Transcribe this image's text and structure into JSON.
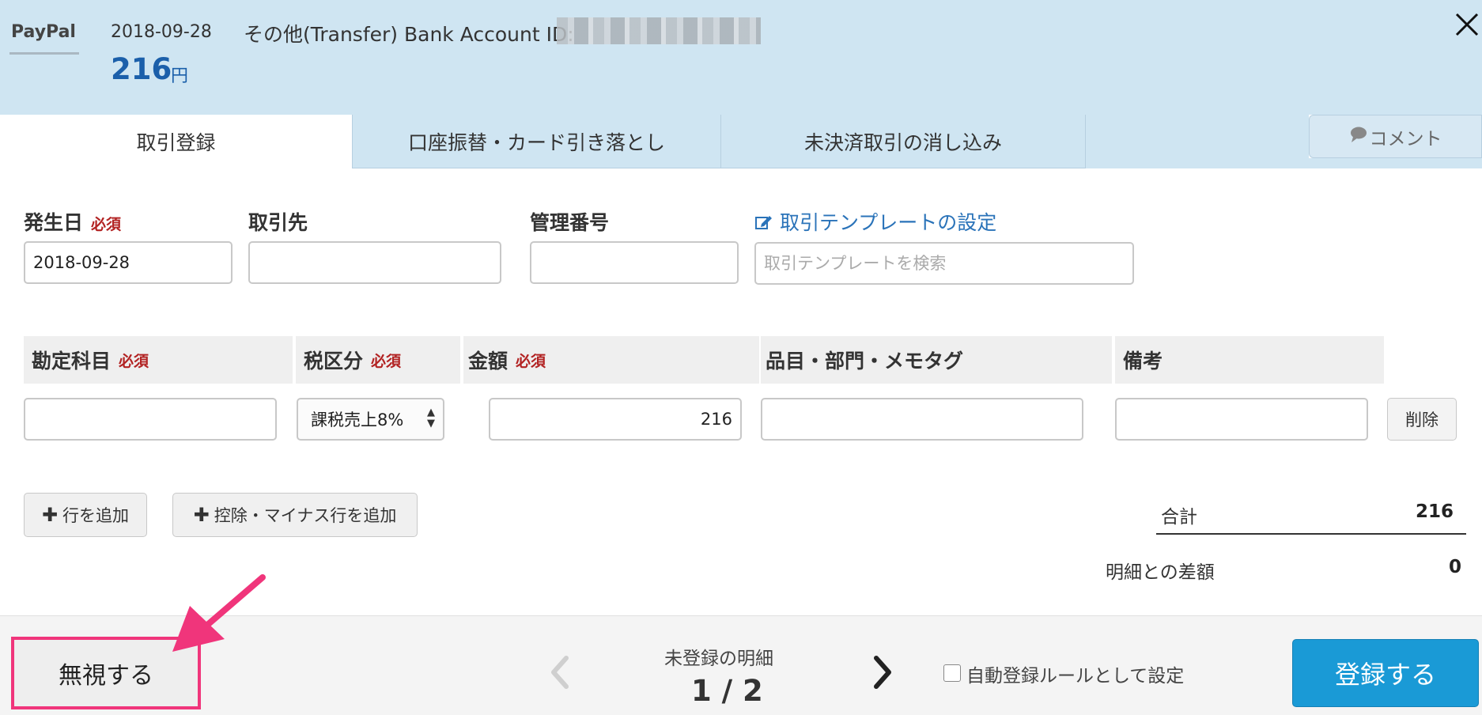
{
  "header": {
    "brand": "PayPal",
    "date": "2018-09-28",
    "amount": "216",
    "amount_unit": "円",
    "description": "その他(Transfer) Bank Account ID:"
  },
  "tabs": [
    {
      "label": "取引登録",
      "active": true
    },
    {
      "label": "口座振替・カード引き落とし",
      "active": false
    },
    {
      "label": "未決済取引の消し込み",
      "active": false
    }
  ],
  "comment": {
    "label": "コメント",
    "icon": "speech-bubble-icon"
  },
  "form": {
    "date_label": "発生日",
    "required": "必須",
    "date_value": "2018-09-28",
    "partner_label": "取引先",
    "partner_value": "",
    "mgmt_no_label": "管理番号",
    "mgmt_no_value": "",
    "template_link": "取引テンプレートの設定",
    "template_placeholder": "取引テンプレートを検索"
  },
  "table": {
    "headers": {
      "account": "勘定科目",
      "tax": "税区分",
      "amount": "金額",
      "item": "品目・部門・メモタグ",
      "note": "備考"
    },
    "row": {
      "account": "",
      "tax": "課税売上8%",
      "amount": "216",
      "item": "",
      "note": "",
      "delete_label": "削除"
    }
  },
  "actions": {
    "add_row": "行を追加",
    "add_minus_row": "控除・マイナス行を追加"
  },
  "totals": {
    "total_label": "合計",
    "total_value": "216",
    "diff_label": "明細との差額",
    "diff_value": "0"
  },
  "footer": {
    "ignore_label": "無視する",
    "pager_label": "未登録の明細",
    "pager_count": "1 / 2",
    "rule_label": "自動登録ルールとして設定",
    "rule_checked": false,
    "register_label": "登録する"
  },
  "colors": {
    "header_bg": "#cfe5f2",
    "accent_blue": "#1b5faa",
    "required_red": "#b22222",
    "register_blue": "#1a9ad6",
    "highlight_pink": "#f0357b"
  }
}
